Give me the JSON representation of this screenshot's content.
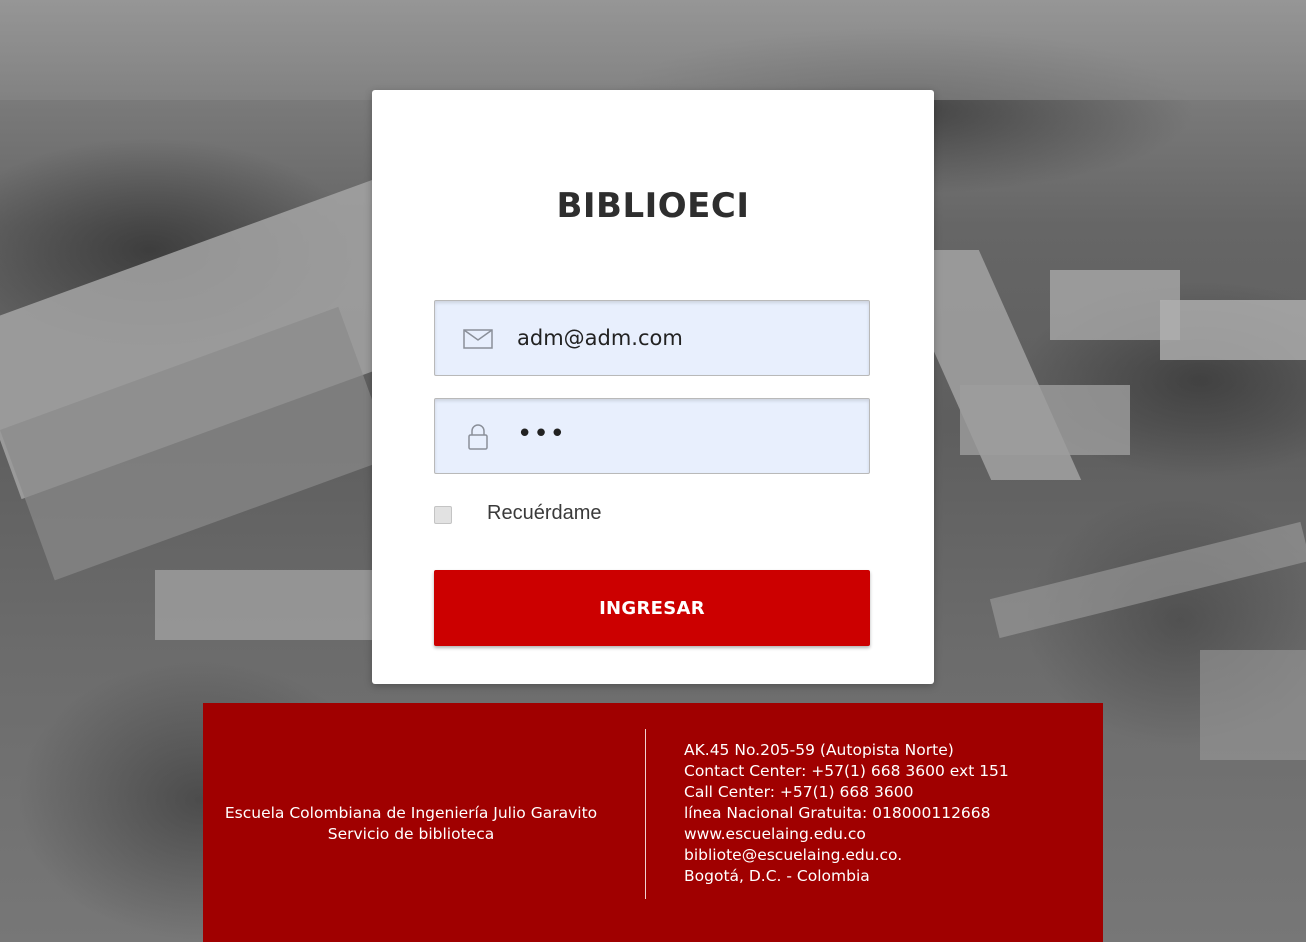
{
  "login": {
    "title": "BIBLIOECI",
    "email": {
      "value": "adm@adm.com",
      "icon": "envelope-icon"
    },
    "password": {
      "masked_value": "•••",
      "icon": "lock-icon"
    },
    "remember_label": "Recuérdame",
    "remember_checked": false,
    "submit_label": "INGRESAR"
  },
  "footer": {
    "left": [
      "Escuela Colombiana de Ingeniería Julio Garavito",
      "Servicio de biblioteca"
    ],
    "right": [
      "AK.45 No.205-59 (Autopista Norte)",
      "Contact Center: +57(1) 668 3600 ext 151",
      "Call Center: +57(1) 668 3600",
      "línea Nacional Gratuita: 018000112668",
      "www.escuelaing.edu.co",
      "bibliote@escuelaing.edu.co.",
      "Bogotá, D.C. - Colombia"
    ]
  },
  "colors": {
    "accent_button": "#cc0000",
    "footer_background": "#a00000",
    "input_background": "#e8effd"
  }
}
